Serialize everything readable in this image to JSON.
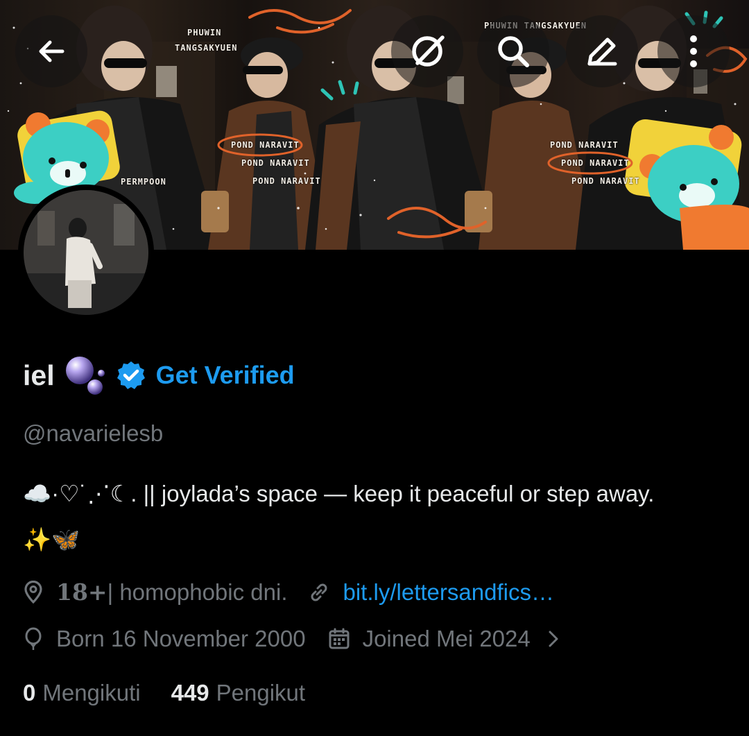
{
  "banner": {
    "texts": {
      "phuwin_line1": "PHUWIN",
      "phuwin_line2": "TANGSAKYUEN",
      "phuwin_top": "PHUWIN TANGSAKYUEN",
      "permpoon": "PERMPOON",
      "pond_1": "POND NARAVIT",
      "pond_2": "POND NARAVIT",
      "pond_3": "POND NARAVIT",
      "pond_4": "POND NARAVIT",
      "pond_5": "POND NARAVIT",
      "pond_6": "POND NARAVIT"
    }
  },
  "nav": {
    "back_icon": "arrow-left-icon",
    "grok_icon": "grok-icon",
    "search_icon": "search-icon",
    "edit_icon": "pencil-icon",
    "more_icon": "more-vertical-icon"
  },
  "profile": {
    "display_name": "iel",
    "name_emoji": "bubbles",
    "get_verified": "Get Verified",
    "handle": "@navarielesb",
    "bio_line1": "☁️·♡˙⋰☾. || joylada’s space — keep it peaceful or step away.",
    "bio_line2": "✨🦋",
    "location_num": "18+",
    "location_text": "| homophobic dni.",
    "website": "bit.ly/lettersandfics…",
    "birthday": "Born 16 November 2000",
    "joined": "Joined Mei 2024",
    "following_count": "0",
    "following_label": "Mengikuti",
    "followers_count": "449",
    "followers_label": "Pengikut"
  },
  "colors": {
    "background": "#000000",
    "primary_text": "#e7e9ea",
    "secondary_text": "#71767b",
    "accent": "#1d9bf0",
    "banner_orange": "#e0622a",
    "banner_teal": "#2ec4b6"
  }
}
